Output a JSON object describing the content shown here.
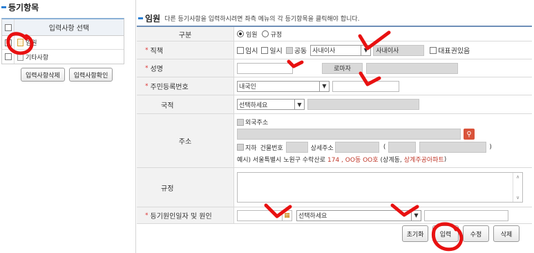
{
  "left": {
    "title": "등기항목",
    "table_header": "입력사항 선택",
    "items": [
      {
        "label": "임원",
        "checked": false
      },
      {
        "label": "기타사항",
        "checked": false
      }
    ],
    "buttons": {
      "delete": "입력사항삭제",
      "confirm": "입력사항확인"
    }
  },
  "main": {
    "title": "임원",
    "description": "다른 등기사항을 입력하시려면 좌측 메뉴의 각 등기항목을 클릭해야 합니다.",
    "rows": {
      "division": {
        "label": "구분",
        "options": [
          "임원",
          "규정"
        ],
        "selected": "임원"
      },
      "position": {
        "label": "직책",
        "checks": [
          "임시",
          "일시",
          "공동"
        ],
        "select_value": "사내이사",
        "readonly_value": "사내이사",
        "rep_check": "대표권있음"
      },
      "name": {
        "label": "성명",
        "roman_label": "로마자"
      },
      "rrn": {
        "label": "주민등록번호",
        "select_value": "내국인"
      },
      "nationality": {
        "label": "국적",
        "select_value": "선택하세요"
      },
      "address": {
        "label": "주소",
        "foreign_check": "외국주소",
        "basement_check": "지하",
        "building_label": "건물번호",
        "detail_label": "상세주소",
        "paren_open": "(",
        "paren_close": ")",
        "example_prefix": "예시) 서울특별시 노원구 수락산로 ",
        "example_red1": "174 , OO동 OO호",
        "example_mid": " (상계동, ",
        "example_red2": "상계주공아파트",
        "example_end": ")"
      },
      "rule": {
        "label": "규정"
      },
      "cause": {
        "label": "등기원인일자 및 원인",
        "select_value": "선택하세요"
      }
    },
    "buttons": {
      "reset": "초기화",
      "input": "입력",
      "edit": "수정",
      "delete": "삭제"
    }
  },
  "colors": {
    "accent": "#2a7fd4",
    "required": "#dd3333",
    "annotation": "#e81111"
  }
}
